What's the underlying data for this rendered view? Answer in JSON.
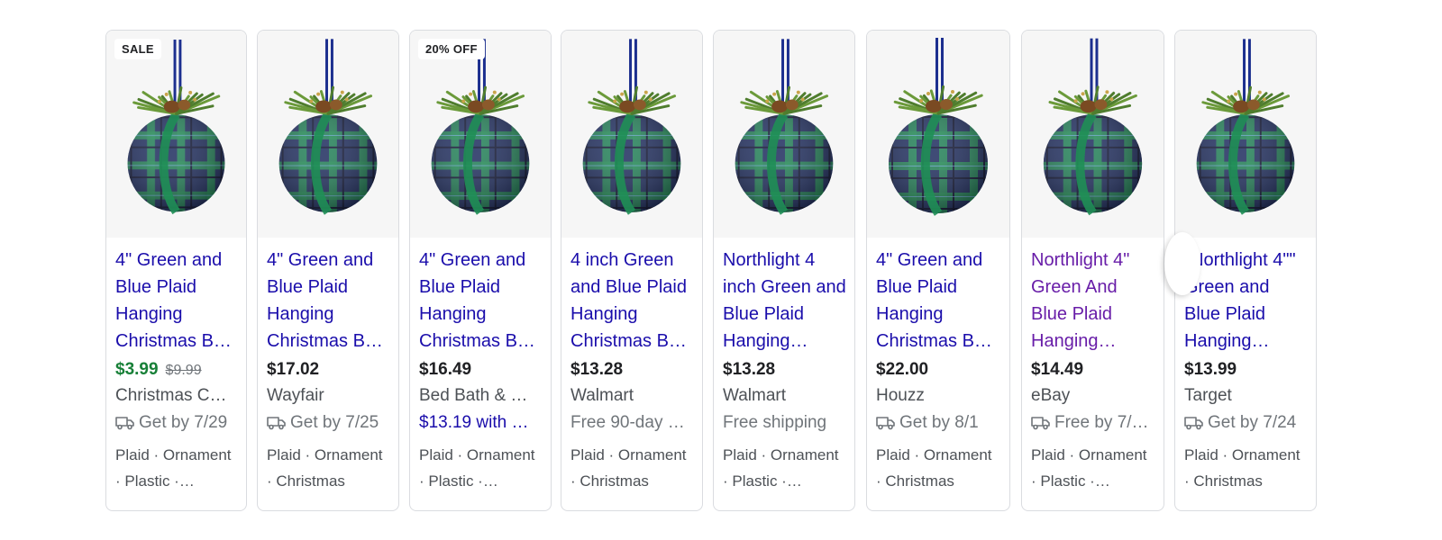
{
  "products": [
    {
      "badge": "SALE",
      "title_lines": [
        "4\" Green and",
        "Blue Plaid",
        "Hanging",
        "Christmas B…"
      ],
      "price": "$3.99",
      "old_price": "$9.99",
      "merchant": "Christmas C…",
      "shipping": "Get by 7/29",
      "shipping_icon": "truck-icon",
      "tag_lines": [
        "Plaid · Ornament",
        "· Plastic ·…"
      ],
      "visited": false
    },
    {
      "badge": "",
      "title_lines": [
        "4\" Green and",
        "Blue Plaid",
        "Hanging",
        "Christmas B…"
      ],
      "price": "$17.02",
      "old_price": "",
      "merchant": "Wayfair",
      "shipping": "Get by 7/25",
      "shipping_icon": "truck-icon",
      "tag_lines": [
        "Plaid · Ornament",
        "· Christmas"
      ],
      "visited": false
    },
    {
      "badge": "20% OFF",
      "title_lines": [
        "4\" Green and",
        "Blue Plaid",
        "Hanging",
        "Christmas B…"
      ],
      "price": "$16.49",
      "old_price": "",
      "merchant": "Bed Bath & …",
      "shipping": "$13.19 with …",
      "shipping_icon": "",
      "tag_lines": [
        "Plaid · Ornament",
        "· Plastic ·…"
      ],
      "visited": false
    },
    {
      "badge": "",
      "title_lines": [
        "4 inch Green",
        "and Blue Plaid",
        "Hanging",
        "Christmas B…"
      ],
      "price": "$13.28",
      "old_price": "",
      "merchant": "Walmart",
      "shipping": "Free 90-day …",
      "shipping_icon": "",
      "tag_lines": [
        "Plaid · Ornament",
        "· Christmas"
      ],
      "visited": false
    },
    {
      "badge": "",
      "title_lines": [
        "Northlight 4",
        "inch Green and",
        "Blue Plaid",
        "Hanging…"
      ],
      "price": "$13.28",
      "old_price": "",
      "merchant": "Walmart",
      "shipping": "Free shipping",
      "shipping_icon": "",
      "tag_lines": [
        "Plaid · Ornament",
        "· Plastic ·…"
      ],
      "visited": false
    },
    {
      "badge": "",
      "title_lines": [
        "4\" Green and",
        "Blue Plaid",
        "Hanging",
        "Christmas B…"
      ],
      "price": "$22.00",
      "old_price": "",
      "merchant": "Houzz",
      "shipping": "Get by 8/1",
      "shipping_icon": "truck-icon",
      "tag_lines": [
        "Plaid · Ornament",
        "· Christmas"
      ],
      "visited": false
    },
    {
      "badge": "",
      "title_lines": [
        "Northlight 4\"",
        "Green And",
        "Blue Plaid",
        "Hanging…"
      ],
      "price": "$14.49",
      "old_price": "",
      "merchant": "eBay",
      "shipping": "Free by 7/…",
      "shipping_icon": "truck-icon",
      "tag_lines": [
        "Plaid · Ornament",
        "· Plastic ·…"
      ],
      "visited": true
    },
    {
      "badge": "",
      "title_lines": [
        "\"Northlight 4\"\"",
        "Green and",
        "Blue Plaid",
        "Hanging…"
      ],
      "price": "$13.99",
      "old_price": "",
      "merchant": "Target",
      "shipping": "Get by 7/24",
      "shipping_icon": "truck-icon",
      "tag_lines": [
        "Plaid · Ornament",
        "· Christmas"
      ],
      "visited": false
    }
  ],
  "colors": {
    "link": "#1a0dab",
    "visited_link": "#681da8",
    "sale_price": "#188038",
    "plaid_navy": "#1b2a5e",
    "plaid_green": "#1f8f55"
  }
}
